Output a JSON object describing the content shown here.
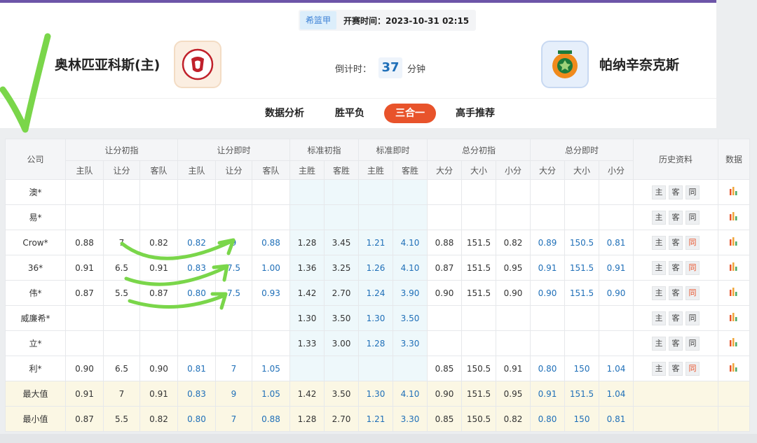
{
  "header": {
    "league": "希篮甲",
    "start_time": "开赛时间：2023-10-31 02:15",
    "home_team": "奥林匹亚科斯(主)",
    "away_team": "帕纳辛奈克斯",
    "countdown_label": "倒计时：",
    "countdown_value": "37",
    "countdown_unit": "分钟"
  },
  "tabs": [
    "数据分析",
    "胜平负",
    "三合一",
    "高手推荐"
  ],
  "active_tab": "三合一",
  "table": {
    "head": {
      "company": "公司",
      "groups": [
        "让分初指",
        "让分即时",
        "标准初指",
        "标准即时",
        "总分初指",
        "总分即时"
      ],
      "history": "历史资料",
      "data": "数据",
      "sub": [
        "主队",
        "让分",
        "客队",
        "主队",
        "让分",
        "客队",
        "主胜",
        "客胜",
        "主胜",
        "客胜",
        "大分",
        "大小",
        "小分",
        "大分",
        "大小",
        "小分"
      ]
    },
    "history_buttons": [
      "主",
      "客",
      "同"
    ],
    "rows": [
      {
        "company": "澳*",
        "cells": [
          "",
          "",
          "",
          "",
          "",
          "",
          "",
          "",
          "",
          "",
          "",
          "",
          "",
          "",
          "",
          ""
        ],
        "same_red": false
      },
      {
        "company": "易*",
        "cells": [
          "",
          "",
          "",
          "",
          "",
          "",
          "",
          "",
          "",
          "",
          "",
          "",
          "",
          "",
          "",
          ""
        ],
        "same_red": false
      },
      {
        "company": "Crow*",
        "cells": [
          "0.88",
          "7",
          "0.82",
          "0.82",
          "9",
          "0.88",
          "1.28",
          "3.45",
          "1.21",
          "4.10",
          "0.88",
          "151.5",
          "0.82",
          "0.89",
          "150.5",
          "0.81"
        ],
        "same_red": true
      },
      {
        "company": "36*",
        "cells": [
          "0.91",
          "6.5",
          "0.91",
          "0.83",
          "7.5",
          "1.00",
          "1.36",
          "3.25",
          "1.26",
          "4.10",
          "0.87",
          "151.5",
          "0.95",
          "0.91",
          "151.5",
          "0.91"
        ],
        "same_red": true
      },
      {
        "company": "伟*",
        "cells": [
          "0.87",
          "5.5",
          "0.87",
          "0.80",
          "7.5",
          "0.93",
          "1.42",
          "2.70",
          "1.24",
          "3.90",
          "0.90",
          "151.5",
          "0.90",
          "0.90",
          "151.5",
          "0.90"
        ],
        "same_red": true
      },
      {
        "company": "威廉希*",
        "cells": [
          "",
          "",
          "",
          "",
          "",
          "",
          "1.30",
          "3.50",
          "1.30",
          "3.50",
          "",
          "",
          "",
          "",
          "",
          ""
        ],
        "same_red": false
      },
      {
        "company": "立*",
        "cells": [
          "",
          "",
          "",
          "",
          "",
          "",
          "1.33",
          "3.00",
          "1.28",
          "3.30",
          "",
          "",
          "",
          "",
          "",
          ""
        ],
        "same_red": false
      },
      {
        "company": "利*",
        "cells": [
          "0.90",
          "6.5",
          "0.90",
          "0.81",
          "7",
          "1.05",
          "",
          "",
          "",
          "",
          "0.85",
          "150.5",
          "0.91",
          "0.80",
          "150",
          "1.04"
        ],
        "same_red": true
      }
    ],
    "summary": [
      {
        "label": "最大值",
        "cells": [
          "0.91",
          "7",
          "0.91",
          "0.83",
          "9",
          "1.05",
          "1.42",
          "3.50",
          "1.30",
          "4.10",
          "0.90",
          "151.5",
          "0.95",
          "0.91",
          "151.5",
          "1.04"
        ]
      },
      {
        "label": "最小值",
        "cells": [
          "0.87",
          "5.5",
          "0.82",
          "0.80",
          "7",
          "0.88",
          "1.28",
          "2.70",
          "1.21",
          "3.30",
          "0.85",
          "150.5",
          "0.82",
          "0.80",
          "150",
          "0.81"
        ]
      }
    ]
  },
  "colors": {
    "accent": "#e8532b",
    "blue_value": "#1f6fb8",
    "annotation_green": "#7ad64a",
    "top_strip": "#6d55a8"
  }
}
